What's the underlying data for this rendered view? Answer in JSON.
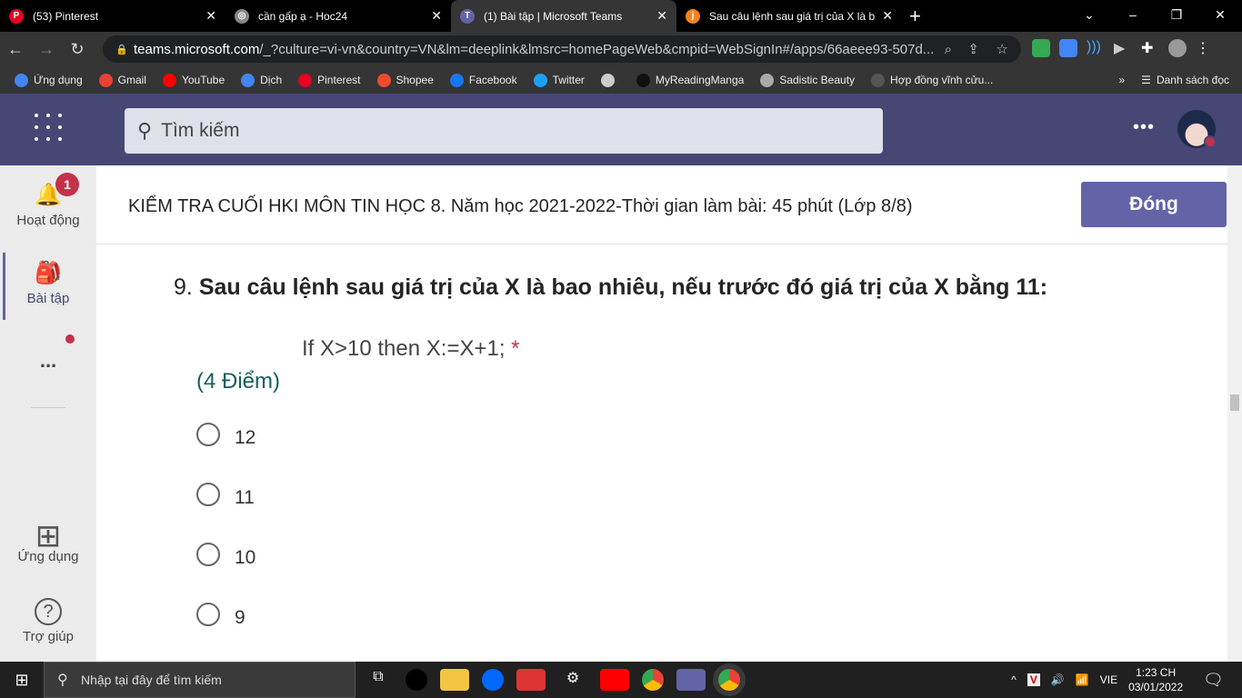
{
  "browser": {
    "tabs": [
      {
        "title": "(53) Pinterest",
        "icon": "pinterest-icon",
        "color": "#e60023",
        "glyph": "P"
      },
      {
        "title": "cần gấp ạ - Hoc24",
        "icon": "globe-icon",
        "color": "#888888",
        "glyph": "◎"
      },
      {
        "title": "(1) Bài tập | Microsoft Teams",
        "icon": "teams-icon",
        "color": "#6264a7",
        "glyph": "T"
      },
      {
        "title": "Sau câu lệnh sau giá trị của X là b",
        "icon": "j-icon",
        "color": "#f5821f",
        "glyph": "j"
      }
    ],
    "url_host": "teams.microsoft.com",
    "url_rest": "/_?culture=vi-vn&country=VN&lm=deeplink&lmsrc=homePageWeb&cmpid=WebSignIn#/apps/66aeee93-507d...",
    "bookmarks": [
      {
        "label": "Ứng dụng",
        "color": "#4285f4"
      },
      {
        "label": "Gmail",
        "color": "#ea4335"
      },
      {
        "label": "YouTube",
        "color": "#ff0000"
      },
      {
        "label": "Dịch",
        "color": "#4285f4"
      },
      {
        "label": "Pinterest",
        "color": "#e60023"
      },
      {
        "label": "Shopee",
        "color": "#ee4d2d"
      },
      {
        "label": "Facebook",
        "color": "#1877f2"
      },
      {
        "label": "Twitter",
        "color": "#1da1f2"
      },
      {
        "label": "",
        "color": "#cccccc"
      },
      {
        "label": "MyReadingManga",
        "color": "#111111"
      },
      {
        "label": "Sadistic Beauty",
        "color": "#aaaaaa"
      },
      {
        "label": "Hợp đồng vĩnh cửu...",
        "color": "#555555"
      }
    ],
    "reading_list": "Danh sách đọc"
  },
  "teams": {
    "search_placeholder": "Tìm kiếm",
    "sidebar": [
      {
        "label": "Hoạt động",
        "icon": "bell-icon",
        "glyph": "🔔",
        "badge": "1"
      },
      {
        "label": "Bài tập",
        "icon": "backpack-icon",
        "glyph": "🎒"
      },
      {
        "label": "...",
        "icon": "more-icon"
      },
      {
        "label": "Ứng dụng",
        "icon": "apps-icon",
        "glyph": "⊞"
      },
      {
        "label": "Trợ giúp",
        "icon": "help-icon",
        "glyph": "?"
      }
    ],
    "title": "KIỂM TRA CUỐI HKI MÔN TIN HỌC 8. Năm học 2021-2022-Thời gian làm bài: 45 phút (Lớp 8/8)",
    "close_label": "Đóng"
  },
  "question": {
    "number": "9.",
    "text": "Sau câu lệnh sau giá trị của X là bao nhiêu, nếu trước đó giá trị của X bằng 11:",
    "code": "If X>10 then X:=X+1;",
    "required": "*",
    "points": "(4 Điểm)",
    "options": [
      "12",
      "11",
      "10",
      "9"
    ]
  },
  "taskbar": {
    "search_placeholder": "Nhập tại đây để tìm kiếm",
    "lang": "VIE",
    "time": "1:23 CH",
    "date": "03/01/2022"
  }
}
